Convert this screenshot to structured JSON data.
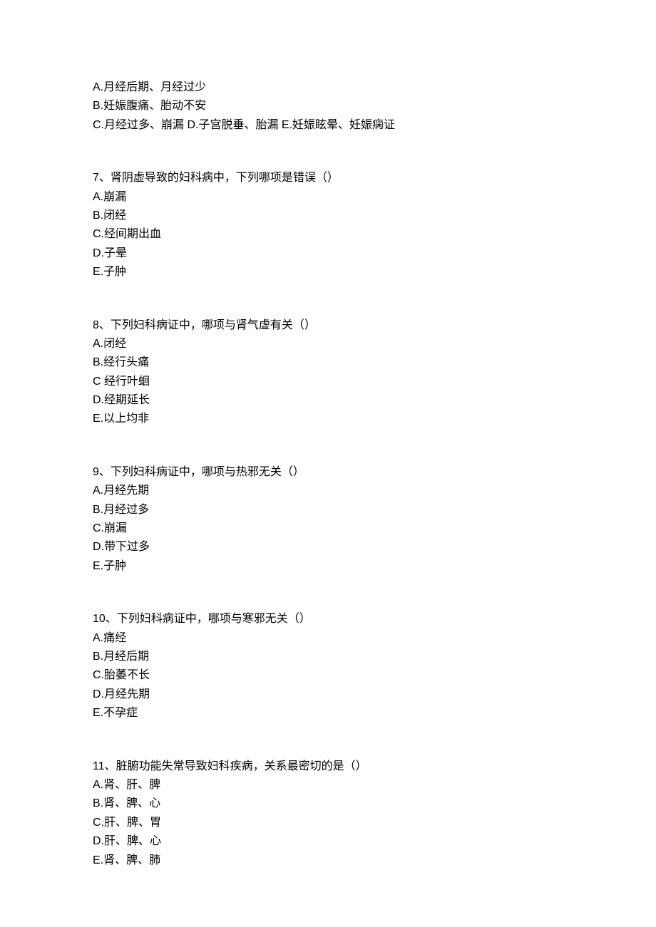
{
  "q6": {
    "optA": "A.月经后期、月经过少",
    "optB": "B.妊娠腹痛、胎动不安",
    "optC_part1": "C.月经过多、崩漏 ",
    "optC_part2": "D.子宫脱垂、胎漏 ",
    "optC_part3": "E.妊娠眩晕、妊娠痫证"
  },
  "q7": {
    "stem": "7、肾阴虚导致的妇科病中，下列哪项是错误（）",
    "optA": "A.崩漏",
    "optB": "B.闭经",
    "optC": "C.经间期出血",
    "optD": "D.子晕",
    "optE": "E.子肿"
  },
  "q8": {
    "stem": "8、下列妇科病证中，哪项与肾气虚有关（）",
    "optA": "A.闭经",
    "optB": "B.经行头痛",
    "optC": "C 经行叶蛔",
    "optD": "D.经期延长",
    "optE": "E.以上均非"
  },
  "q9": {
    "stem": "9、下列妇科病证中，哪项与热邪无关（）",
    "optA": "A.月经先期",
    "optB": "B.月经过多",
    "optC": "C.崩漏",
    "optD": "D.带下过多",
    "optE": "E.子肿"
  },
  "q10": {
    "stem": "10、下列妇科病证中，哪项与寒邪无关（）",
    "optA": "A.痛经",
    "optB": "B.月经后期",
    "optC": "C.胎萎不长",
    "optD": "D.月经先期",
    "optE": "E.不孕症"
  },
  "q11": {
    "stem": "11、脏腑功能失常导致妇科疾病，关系最密切的是（）",
    "optA": "A.肾、肝、脾",
    "optB": "B.肾、脾、心",
    "optC": "C.肝、脾、胃",
    "optD": "D.肝、脾、心",
    "optE": "E.肾、脾、肺"
  }
}
